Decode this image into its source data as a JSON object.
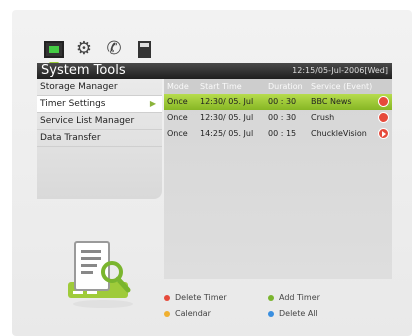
{
  "header": {
    "title": "System Tools",
    "datetime": "12:15/05-Jul-2006[Wed]"
  },
  "top_icons": [
    "monitor-icon",
    "gears-icon",
    "satellite-dish-icon",
    "calculator-icon"
  ],
  "menu": {
    "items": [
      {
        "label": "Storage Manager"
      },
      {
        "label": "Timer Settings",
        "selected": true
      },
      {
        "label": "Service List Manager"
      },
      {
        "label": "Data Transfer"
      }
    ]
  },
  "table": {
    "headers": {
      "mode": "Mode",
      "start": "Start Time",
      "duration": "Duration",
      "service": "Service (Event)"
    },
    "rows": [
      {
        "mode": "Once",
        "start": "12:30/ 05. Jul",
        "duration": "00 : 30",
        "service": "BBC News",
        "icon": "record-icon"
      },
      {
        "mode": "Once",
        "start": "12:30/ 05. Jul",
        "duration": "00 : 30",
        "service": "Crush",
        "icon": "record-icon"
      },
      {
        "mode": "Once",
        "start": "14:25/ 05. Jul",
        "duration": "00 : 15",
        "service": "ChuckleVision",
        "icon": "play-icon"
      }
    ]
  },
  "legend": {
    "delete_timer": "Delete Timer",
    "add_timer": "Add Timer",
    "calendar": "Calendar",
    "delete_all": "Delete All"
  },
  "colors": {
    "red_key": "#e64a3b",
    "green_key": "#7ab52e",
    "yellow_key": "#f0b030",
    "blue_key": "#3a8fe0",
    "selection_green": "#9fcb3a"
  }
}
